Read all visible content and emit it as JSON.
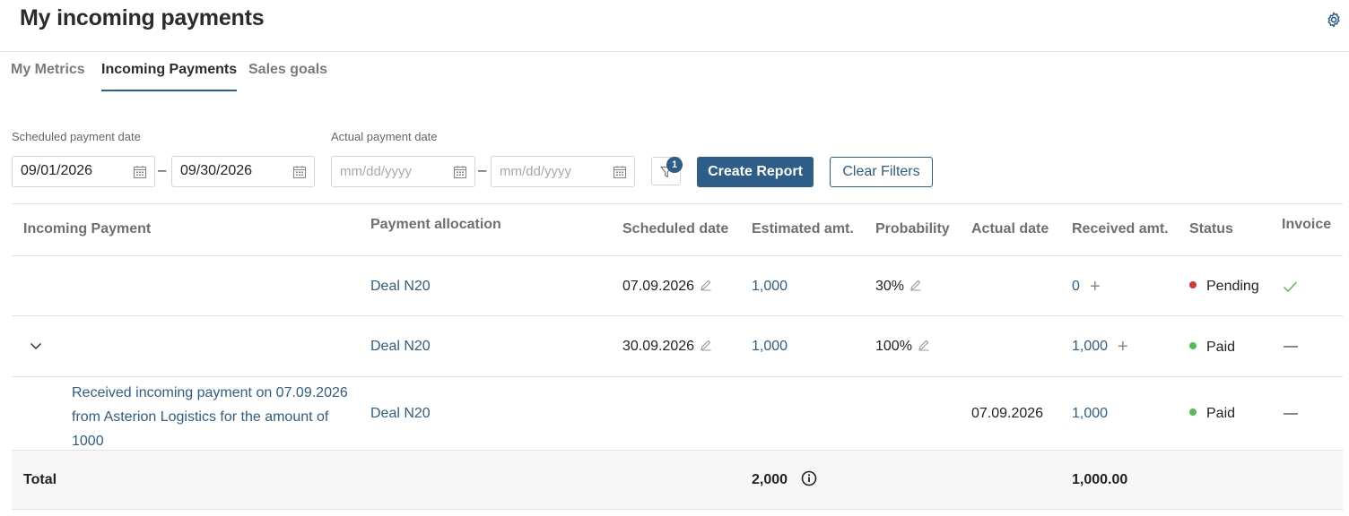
{
  "header": {
    "title": "My incoming payments",
    "settings_icon": "gear-icon"
  },
  "tabs": [
    {
      "label": "My Metrics",
      "active": false
    },
    {
      "label": "Incoming Payments",
      "active": true
    },
    {
      "label": "Sales goals",
      "active": false
    }
  ],
  "filters": {
    "scheduled_label": "Scheduled payment date",
    "scheduled_from": "09/01/2026",
    "scheduled_to": "09/30/2026",
    "actual_label": "Actual payment date",
    "actual_from_placeholder": "mm/dd/yyyy",
    "actual_to_placeholder": "mm/dd/yyyy",
    "dash": "–",
    "filter_count": "1",
    "create_report": "Create Report",
    "clear_filters": "Clear Filters"
  },
  "table": {
    "columns": {
      "incoming_payment": "Incoming Payment",
      "payment_allocation": "Payment allocation",
      "scheduled_date": "Scheduled date",
      "estimated_amt": "Estimated amt.",
      "probability": "Probability",
      "actual_date": "Actual date",
      "received_amt": "Received amt.",
      "status": "Status",
      "invoice": "Invoice"
    },
    "rows": [
      {
        "allocation": "Deal N20",
        "scheduled": "07.09.2026",
        "estimated": "1,000",
        "probability": "30%",
        "received": "0",
        "status": "Pending",
        "status_color": "#d9353b",
        "invoice": "✓"
      },
      {
        "allocation": "Deal N20",
        "scheduled": "30.09.2026",
        "estimated": "1,000",
        "probability": "100%",
        "received": "1,000",
        "status": "Paid",
        "status_color": "#5cb85c",
        "invoice": "—"
      },
      {
        "payment": "Received incoming payment on 07.09.2026 from Asterion Logistics for the amount of 1000",
        "allocation": "Deal N20",
        "actual": "07.09.2026",
        "received": "1,000",
        "status": "Paid",
        "status_color": "#5cb85c",
        "invoice": "—"
      }
    ],
    "total": {
      "label": "Total",
      "estimated": "2,000",
      "received": "1,000.00"
    }
  },
  "colors": {
    "accent": "#2e5d8a",
    "pending": "#d9353b",
    "paid": "#5cb85c",
    "check": "#5cb85c"
  }
}
